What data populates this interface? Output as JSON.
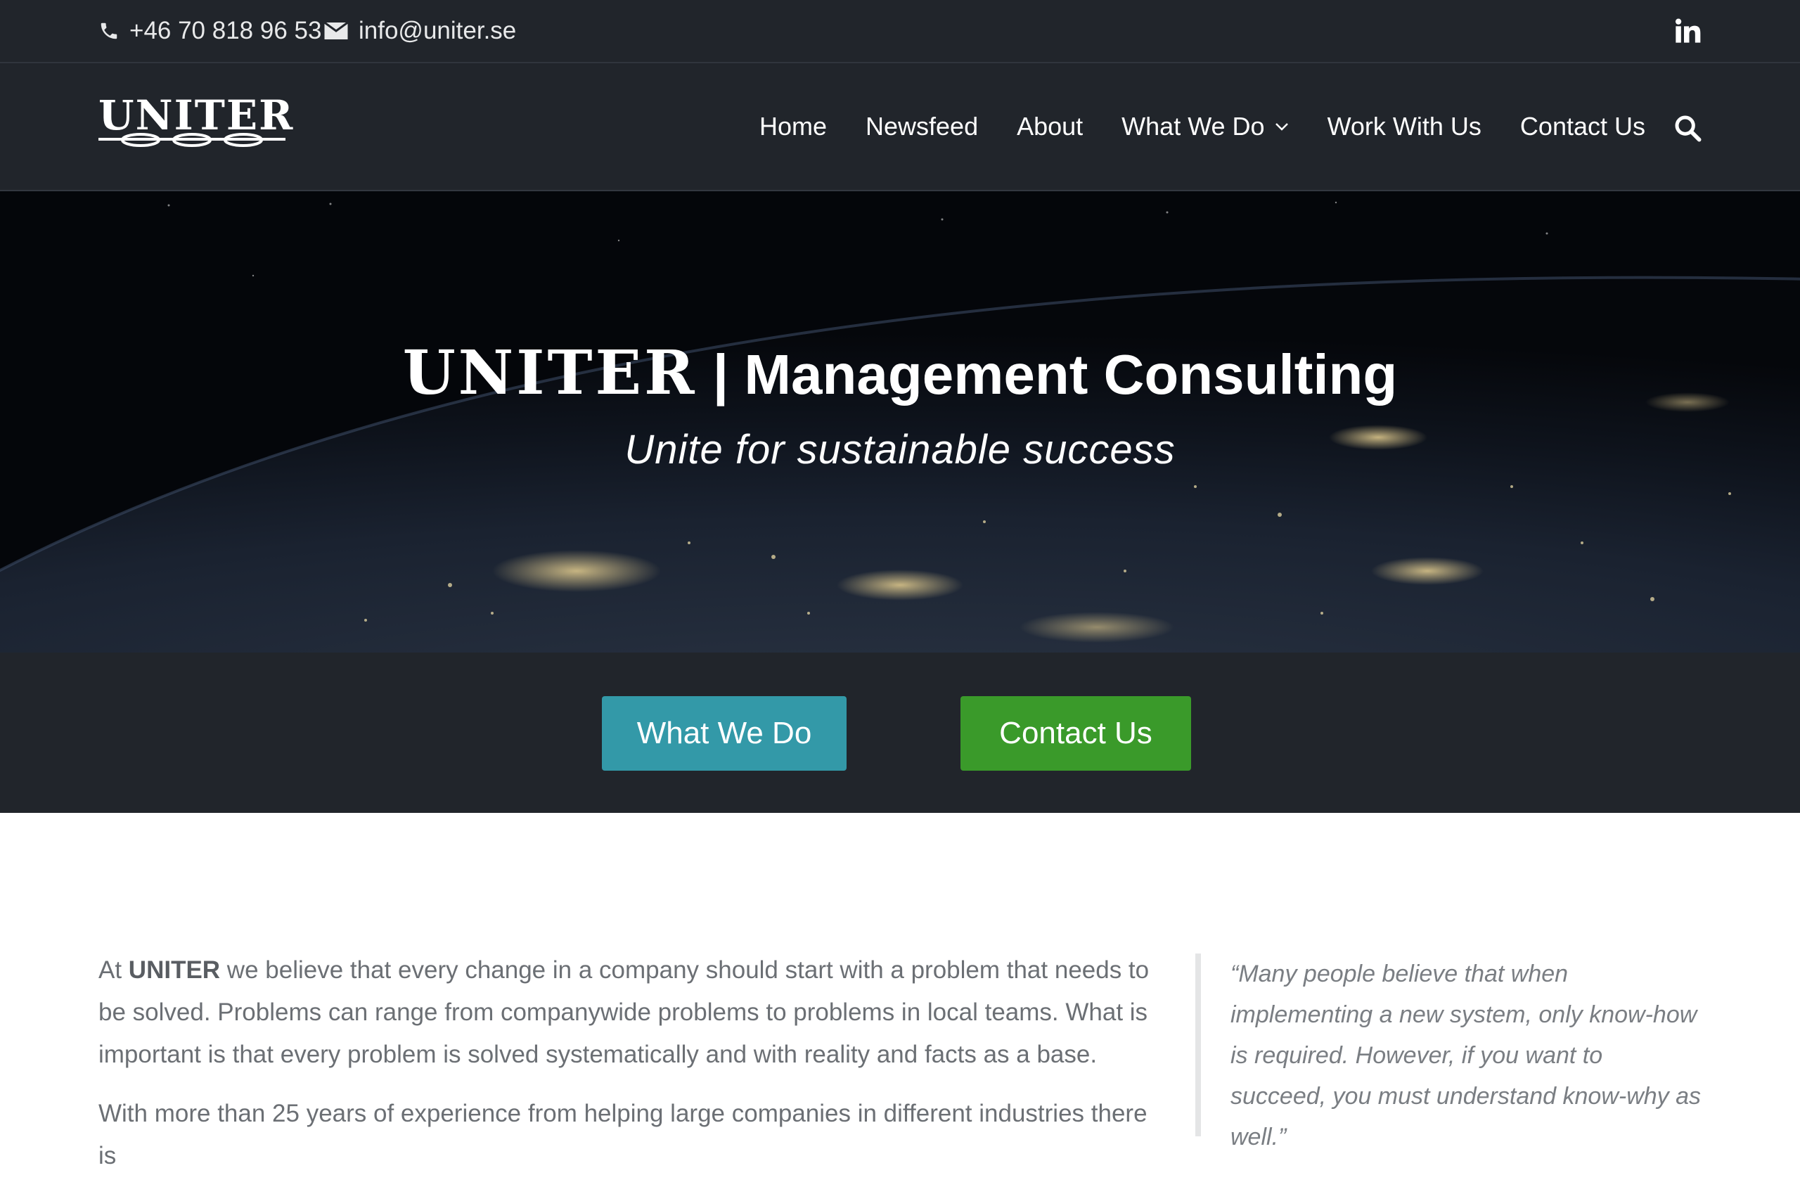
{
  "topbar": {
    "phone": "+46 70 818 96 53",
    "email": "info@uniter.se",
    "social_icon": "linkedin-icon"
  },
  "header": {
    "logo_text": "UNITER",
    "nav": [
      {
        "label": "Home"
      },
      {
        "label": "Newsfeed"
      },
      {
        "label": "About"
      },
      {
        "label": "What We Do",
        "dropdown": true
      },
      {
        "label": "Work With Us"
      },
      {
        "label": "Contact Us"
      }
    ],
    "search_icon": "search-icon"
  },
  "hero": {
    "brand": "UNITER",
    "title_rest": " | Management Consulting",
    "subtitle": "Unite for sustainable success"
  },
  "cta": {
    "what_we_do": "What We Do",
    "contact_us": "Contact Us",
    "colors": {
      "what_we_do": "#3399a8",
      "contact_us": "#3a9a2a"
    }
  },
  "content": {
    "p1_prefix": "At ",
    "p1_brand": "UNITER",
    "p1_rest": " we believe that every change in a company should start with a problem that needs to be solved. Problems can range from companywide problems to problems in local teams. What is important is that every problem is solved systematically and with reality and facts as a base.",
    "p2": "With more than 25 years of experience from helping large companies in different industries there is",
    "quote": "“Many people believe that when implementing a new system, only know-how is required. However, if you want to succeed, you must understand know-why as well.”"
  },
  "colors": {
    "bar_bg": "#21252b",
    "accent_teal": "#3399a8",
    "accent_green": "#3a9a2a"
  }
}
